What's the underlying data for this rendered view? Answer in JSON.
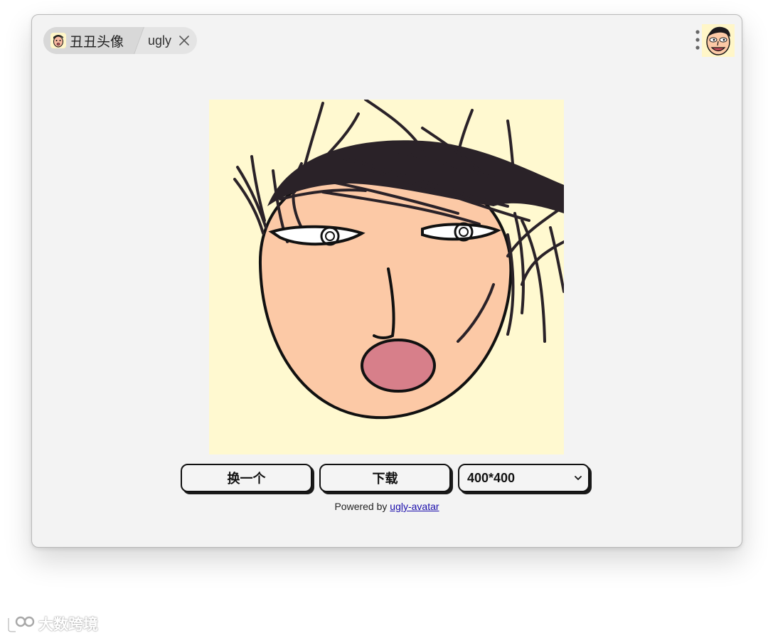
{
  "tabs": {
    "app_title": "丑丑头像",
    "page_title": "ugly"
  },
  "controls": {
    "change_label": "换一个",
    "download_label": "下载",
    "size_selected": "400*400"
  },
  "footer": {
    "powered_prefix": "Powered by ",
    "powered_link": "ugly-avatar"
  },
  "watermark": {
    "text": "大数跨境"
  },
  "icons": {
    "tab_app_icon": "ugly-face-favicon",
    "close": "close-icon",
    "more": "more-vertical-icon",
    "profile": "ugly-face-avatar",
    "dropdown": "chevron-down-icon"
  },
  "colors": {
    "canvas_bg": "#fff9d0",
    "skin": "#fcc9a6",
    "hair": "#2a2228",
    "mouth": "#d77f8a",
    "link": "#1a0dab"
  }
}
